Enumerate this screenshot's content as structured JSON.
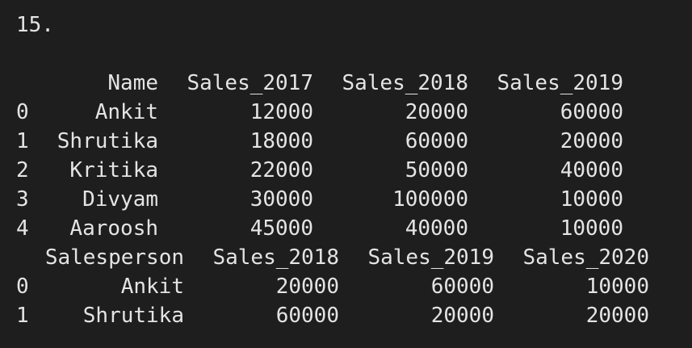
{
  "output": {
    "header_line": "15.",
    "df1": {
      "columns": [
        "",
        "Name",
        "Sales_2017",
        "Sales_2018",
        "Sales_2019"
      ],
      "rows": [
        [
          "0",
          "Ankit",
          "12000",
          "20000",
          "60000"
        ],
        [
          "1",
          "Shrutika",
          "18000",
          "60000",
          "20000"
        ],
        [
          "2",
          "Kritika",
          "22000",
          "50000",
          "40000"
        ],
        [
          "3",
          "Divyam",
          "30000",
          "100000",
          "10000"
        ],
        [
          "4",
          "Aaroosh",
          "45000",
          "40000",
          "10000"
        ]
      ]
    },
    "df2": {
      "columns": [
        "",
        "Salesperson",
        "Sales_2018",
        "Sales_2019",
        "Sales_2020"
      ],
      "rows": [
        [
          "0",
          "Ankit",
          "20000",
          "60000",
          "10000"
        ],
        [
          "1",
          "Shrutika",
          "60000",
          "20000",
          "20000"
        ]
      ]
    }
  }
}
